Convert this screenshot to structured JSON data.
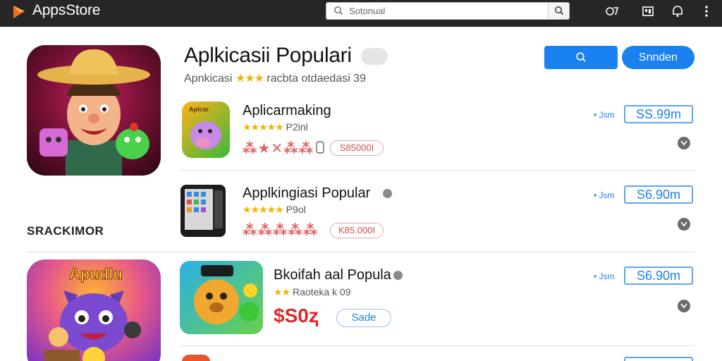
{
  "topbar": {
    "brand": "AppsStore",
    "search_placeholder": "Sotonual",
    "icons": [
      "logo-icon",
      "search-icon",
      "account-icon",
      "gallery-icon",
      "notifications-icon",
      "more-icon"
    ]
  },
  "header": {
    "title": "Aplkicasii Populari",
    "subtitle_prefix": "Apnkicasi",
    "subtitle_stars": "★★★",
    "subtitle_suffix": "racbta otdaedasi 39",
    "primary_button": "Snnden"
  },
  "sidebar": {
    "section_label": "SRACKIMOR"
  },
  "apps": [
    {
      "name": "Aplicarmaking",
      "stars": "★★★★★",
      "rating_text": "P2inl",
      "deco": "⁂★✕⁂⁂",
      "deco_text": "1⁂",
      "pill": "S85000I",
      "size": "• Jsm",
      "price": "SS.99m"
    },
    {
      "name": "Applkingiasi Popular",
      "stars": "★★★★★",
      "rating_text": "P9ol",
      "deco": "⁂⁂⁂⁂⁂",
      "pill": "K85.000I",
      "size": "• Jsm",
      "price": "S6.90m"
    },
    {
      "name": "Bkoifah aal Popula",
      "stars": "★★",
      "rating_text": "Raoteka k 09",
      "big_price": "$S0ⱬ",
      "pill": "Sade",
      "size": "• Jsm",
      "price": "S6.90m"
    }
  ],
  "colors": {
    "accent": "#1a82f0",
    "topbar": "#262626",
    "star": "#f0b400",
    "price_red": "#e02828"
  }
}
